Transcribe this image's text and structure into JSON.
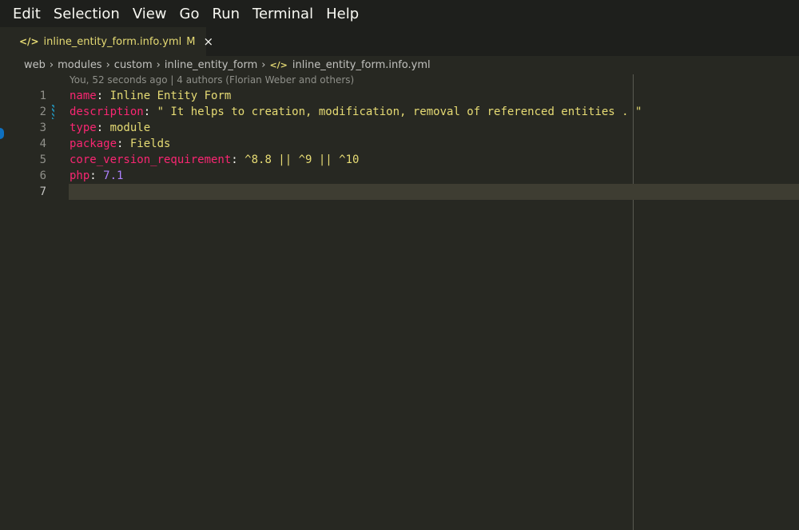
{
  "menu": {
    "items": [
      "Edit",
      "Selection",
      "View",
      "Go",
      "Run",
      "Terminal",
      "Help"
    ]
  },
  "tab": {
    "icon": "code-file-icon",
    "filename": "inline_entity_form.info.yml",
    "status": "M",
    "close": "×"
  },
  "breadcrumb": {
    "items": [
      "web",
      "modules",
      "custom",
      "inline_entity_form",
      "inline_entity_form.info.yml"
    ],
    "separator": "›"
  },
  "blame": "You, 52 seconds ago | 4 authors (Florian Weber and others)",
  "editor": {
    "lines": [
      {
        "n": "1",
        "key": "name",
        "colon": ": ",
        "value": "Inline Entity Form",
        "vtype": "val"
      },
      {
        "n": "2",
        "key": "description",
        "colon": ": ",
        "value": "\" It helps to creation, modification, removal of referenced entities . \"",
        "vtype": "val"
      },
      {
        "n": "3",
        "key": "type",
        "colon": ": ",
        "value": "module",
        "vtype": "val"
      },
      {
        "n": "4",
        "key": "package",
        "colon": ": ",
        "value": "Fields",
        "vtype": "val"
      },
      {
        "n": "5",
        "key": "core_version_requirement",
        "colon": ": ",
        "value": "^8.8 || ^9 || ^10",
        "vtype": "val"
      },
      {
        "n": "6",
        "key": "php",
        "colon": ": ",
        "value": "7.1",
        "vtype": "num"
      },
      {
        "n": "7",
        "key": "",
        "colon": "",
        "value": "",
        "vtype": "val"
      }
    ],
    "active_line": 7
  },
  "colors": {
    "background": "#272822",
    "key": "#f92672",
    "string": "#e6db74",
    "number": "#ae81ff"
  }
}
